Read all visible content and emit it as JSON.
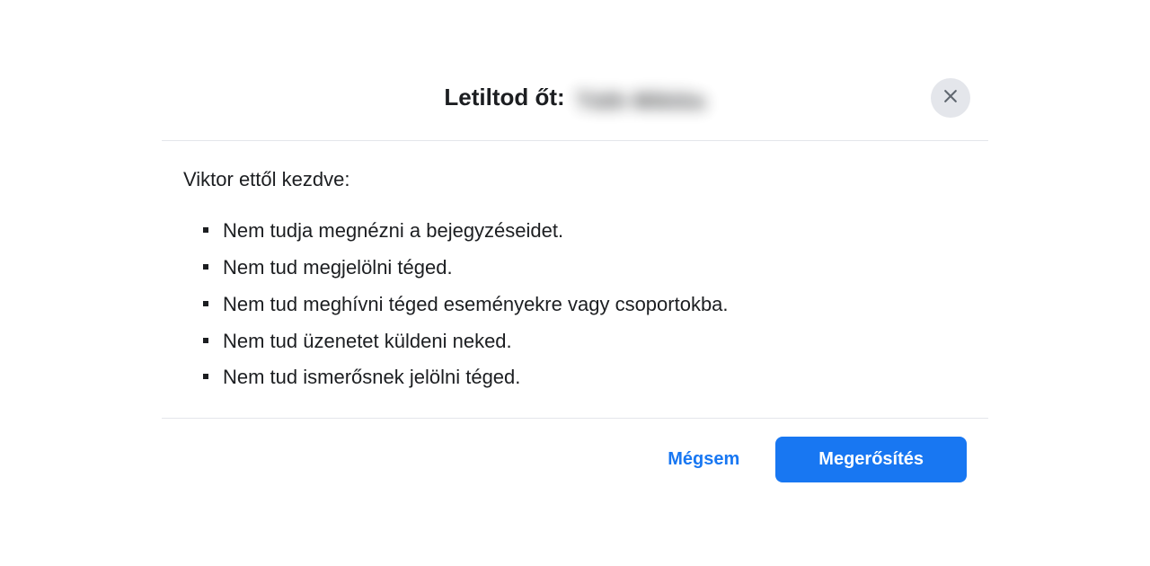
{
  "dialog": {
    "title_prefix": "Letiltod őt:",
    "title_name": "Tóth  Miklós",
    "intro": "Viktor ettől kezdve:",
    "items": [
      "Nem tudja megnézni a bejegyzéseidet.",
      "Nem tud megjelölni téged.",
      "Nem tud meghívni téged eseményekre vagy csoportokba.",
      "Nem tud üzenetet küldeni neked.",
      "Nem tud ismerősnek jelölni téged."
    ],
    "cancel_label": "Mégsem",
    "confirm_label": "Megerősítés"
  }
}
